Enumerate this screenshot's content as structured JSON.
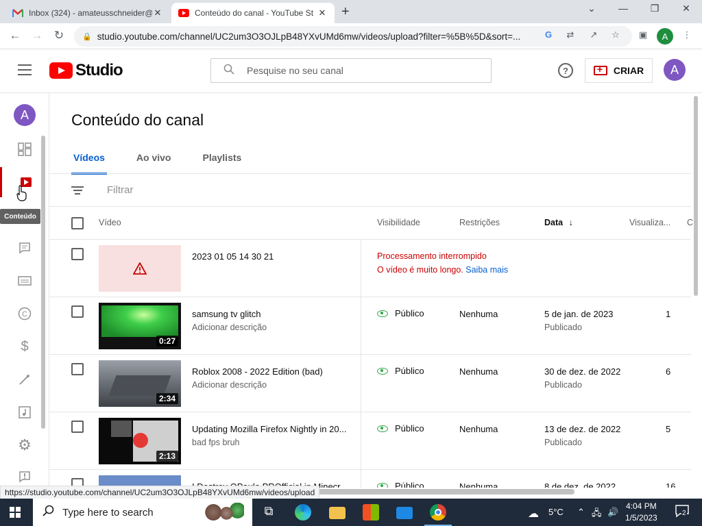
{
  "browser": {
    "tabs": [
      {
        "title": "Inbox (324) - amateusschneider@",
        "icon": "gmail-icon"
      },
      {
        "title": "Conteúdo do canal - YouTube St",
        "icon": "youtube-icon"
      }
    ],
    "url": "studio.youtube.com/channel/UC2um3O3OJLpB48YXvUMd6mw/videos/upload?filter=%5B%5D&sort=...",
    "profile_initial": "A",
    "status_url": "https://studio.youtube.com/channel/UC2um3O3OJLpB48YXvUMd6mw/videos/upload"
  },
  "header": {
    "logo_text": "Studio",
    "search_placeholder": "Pesquise no seu canal",
    "create_label": "CRIAR",
    "avatar_initial": "A"
  },
  "rail": {
    "avatar_initial": "A",
    "tooltip": "Conteúdo",
    "items": [
      "dashboard-icon",
      "content-icon",
      "comments-icon",
      "subtitles-icon",
      "copyright-icon",
      "monetization-icon",
      "customization-icon",
      "audio-library-icon",
      "settings-icon",
      "feedback-icon"
    ]
  },
  "main": {
    "title": "Conteúdo do canal",
    "tabs": [
      "Vídeos",
      "Ao vivo",
      "Playlists"
    ],
    "active_tab": "Vídeos",
    "filter_placeholder": "Filtrar",
    "columns": {
      "video": "Vídeo",
      "visibility": "Visibilidade",
      "restrictions": "Restrições",
      "date": "Data",
      "views": "Visualiza...",
      "next": "C"
    },
    "rows": [
      {
        "title": "2023 01 05 14 30 21",
        "error_title": "Processamento interrompido",
        "error_detail": "O vídeo é muito longo.",
        "error_link": "Saiba mais"
      },
      {
        "title": "samsung tv glitch",
        "description": "Adicionar descrição",
        "duration": "0:27",
        "visibility": "Público",
        "restrictions": "Nenhuma",
        "date": "5 de jan. de 2023",
        "status": "Publicado",
        "views": "1"
      },
      {
        "title": "Roblox 2008 - 2022 Edition (bad)",
        "description": "Adicionar descrição",
        "duration": "2:34",
        "visibility": "Público",
        "restrictions": "Nenhuma",
        "date": "30 de dez. de 2022",
        "status": "Publicado",
        "views": "6"
      },
      {
        "title": "Updating Mozilla Firefox Nightly in 20...",
        "description": "bad fps bruh",
        "duration": "2:13",
        "visibility": "Público",
        "restrictions": "Nenhuma",
        "date": "13 de dez. de 2022",
        "status": "Publicado",
        "views": "5"
      },
      {
        "title": "I Destroy OPaulo PROfficial in Minecra...",
        "visibility": "Público",
        "restrictions": "Nenhuma",
        "date": "8 de dez. de 2022",
        "views": "16"
      }
    ]
  },
  "taskbar": {
    "search_placeholder": "Type here to search",
    "weather": "5°C",
    "time": "4:04 PM",
    "date": "1/5/2023",
    "notifications": "2"
  }
}
